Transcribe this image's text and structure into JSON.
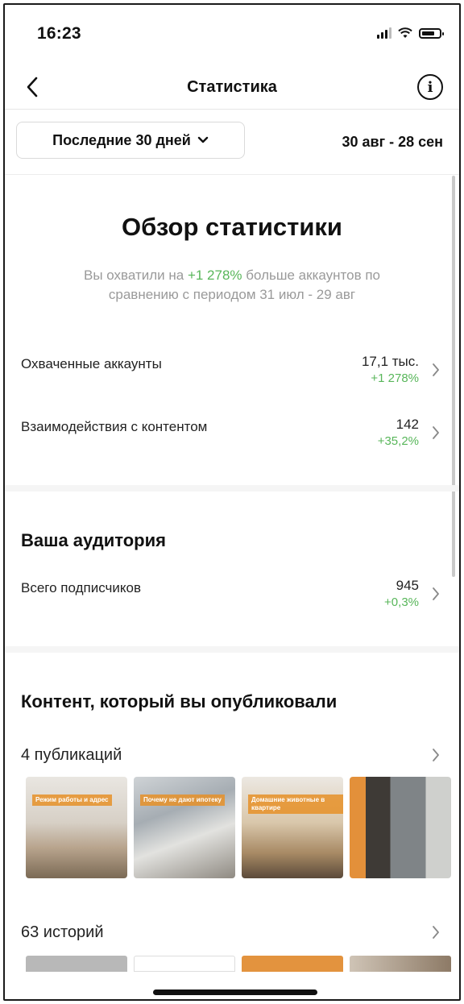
{
  "status_bar": {
    "time": "16:23"
  },
  "nav": {
    "title": "Статистика"
  },
  "filter": {
    "period_label": "Последние 30 дней",
    "date_range": "30 авг - 28 сен"
  },
  "overview": {
    "title": "Обзор статистики",
    "desc_before": "Вы охватили на ",
    "desc_highlight": "+1 278%",
    "desc_after": " больше аккаунтов по сравнению с периодом 31 июл - 29 авг",
    "metrics": [
      {
        "label": "Охваченные аккаунты",
        "value": "17,1 тыс.",
        "change": "+1 278%"
      },
      {
        "label": "Взаимодействия с контентом",
        "value": "142",
        "change": "+35,2%"
      }
    ]
  },
  "audience": {
    "title": "Ваша аудитория",
    "followers": {
      "label": "Всего подписчиков",
      "value": "945",
      "change": "+0,3%"
    }
  },
  "content": {
    "title": "Контент, который вы опубликовали",
    "posts_label": "4 публикаций",
    "post_thumbs": [
      {
        "tag": "Режим работы и адрес"
      },
      {
        "tag": "Почему не дают ипотеку"
      },
      {
        "tag": "Домашние животные в квартире"
      },
      {
        "tag": ""
      }
    ],
    "stories_label": "63 историй"
  },
  "colors": {
    "positive": "#58b65a",
    "muted_text": "#9a9a9a"
  }
}
